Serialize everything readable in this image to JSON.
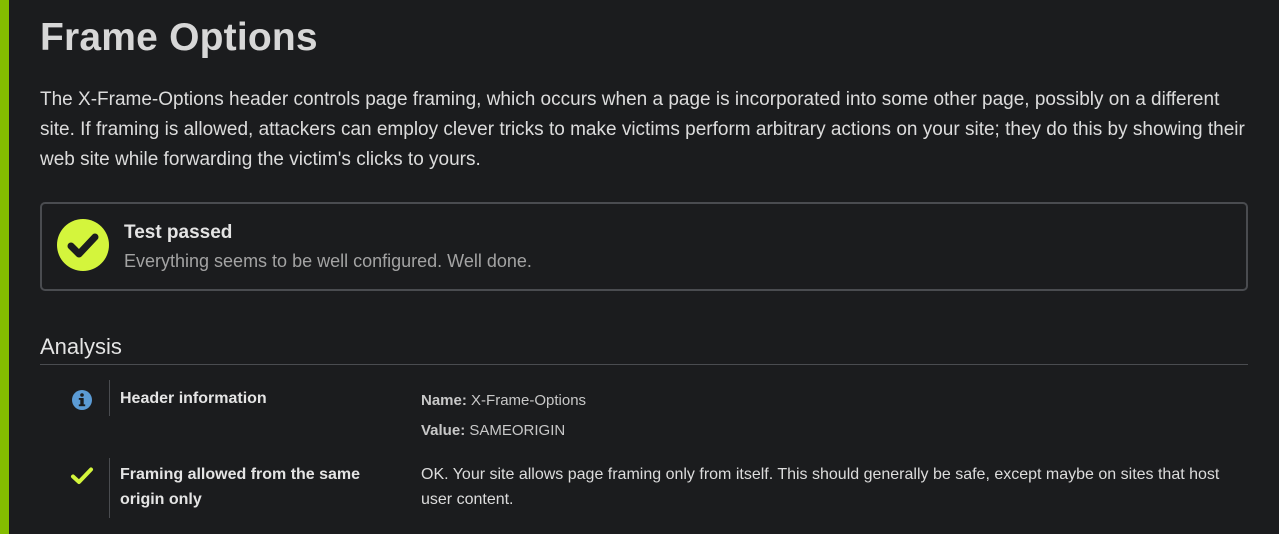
{
  "page": {
    "title": "Frame Options",
    "intro": "The X-Frame-Options header controls page framing, which occurs when a page is incorporated into some other page, possibly on a different site. If framing is allowed, attackers can employ clever tricks to make victims perform arbitrary actions on your site; they do this by showing their web site while forwarding the victim's clicks to yours."
  },
  "result": {
    "icon": "check-circle-icon",
    "title": "Test passed",
    "message": "Everything seems to be well configured. Well done."
  },
  "analysis": {
    "title": "Analysis",
    "rows": [
      {
        "icon": "info-icon",
        "label": "Header information",
        "name_key": "Name:",
        "name_value": "X-Frame-Options",
        "value_key": "Value:",
        "value_value": "SAMEORIGIN"
      },
      {
        "icon": "check-icon",
        "label": "Framing allowed from the same origin only",
        "detail": "OK. Your site allows page framing only from itself. This should generally be safe, except maybe on sites that host user content."
      }
    ]
  },
  "colors": {
    "accent": "#84bd00",
    "pass": "#d4f53c",
    "info": "#5b9bd5",
    "background": "#1b1c1e"
  }
}
